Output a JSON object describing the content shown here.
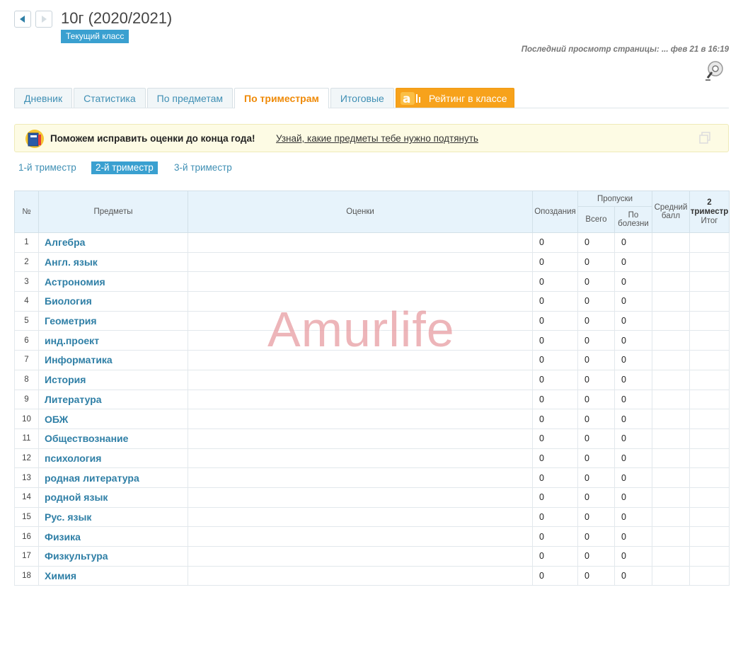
{
  "header": {
    "class_title": "10г (2020/2021)",
    "class_badge": "Текущий класс",
    "last_view": "Последний просмотр страницы: ... фев 21 в 16:19"
  },
  "tabs": [
    {
      "label": "Дневник"
    },
    {
      "label": "Статистика"
    },
    {
      "label": "По предметам"
    },
    {
      "label": "По триместрам"
    },
    {
      "label": "Итоговые"
    },
    {
      "label": "Рейтинг в классе"
    }
  ],
  "active_tab": "По триместрам",
  "banner": {
    "text": "Поможем исправить оценки до конца года!",
    "link": "Узнай, какие предметы тебе нужно подтянуть"
  },
  "trimesters": [
    {
      "label": "1-й триместр"
    },
    {
      "label": "2-й триместр"
    },
    {
      "label": "3-й триместр"
    }
  ],
  "active_trimester": "2-й триместр",
  "table": {
    "headers": {
      "num": "№",
      "subject": "Предметы",
      "grades": "Оценки",
      "late": "Опоздания",
      "absences": "Пропуски",
      "abs_total": "Всего",
      "abs_illness": "По болезни",
      "avg": "Средний балл",
      "final_1": "2",
      "final_2": "триместр",
      "final_3": "Итог"
    },
    "rows": [
      {
        "num": "1",
        "subject": "Алгебра",
        "late": "0",
        "total": "0",
        "illness": "0"
      },
      {
        "num": "2",
        "subject": "Англ. язык",
        "late": "0",
        "total": "0",
        "illness": "0"
      },
      {
        "num": "3",
        "subject": "Астрономия",
        "late": "0",
        "total": "0",
        "illness": "0"
      },
      {
        "num": "4",
        "subject": "Биология",
        "late": "0",
        "total": "0",
        "illness": "0"
      },
      {
        "num": "5",
        "subject": "Геометрия",
        "late": "0",
        "total": "0",
        "illness": "0"
      },
      {
        "num": "6",
        "subject": "инд.проект",
        "late": "0",
        "total": "0",
        "illness": "0"
      },
      {
        "num": "7",
        "subject": "Информатика",
        "late": "0",
        "total": "0",
        "illness": "0"
      },
      {
        "num": "8",
        "subject": "История",
        "late": "0",
        "total": "0",
        "illness": "0"
      },
      {
        "num": "9",
        "subject": "Литература",
        "late": "0",
        "total": "0",
        "illness": "0"
      },
      {
        "num": "10",
        "subject": "ОБЖ",
        "late": "0",
        "total": "0",
        "illness": "0"
      },
      {
        "num": "11",
        "subject": "Обществознание",
        "late": "0",
        "total": "0",
        "illness": "0"
      },
      {
        "num": "12",
        "subject": "психология",
        "late": "0",
        "total": "0",
        "illness": "0"
      },
      {
        "num": "13",
        "subject": "родная литература",
        "late": "0",
        "total": "0",
        "illness": "0"
      },
      {
        "num": "14",
        "subject": "родной язык",
        "late": "0",
        "total": "0",
        "illness": "0"
      },
      {
        "num": "15",
        "subject": "Рус. язык",
        "late": "0",
        "total": "0",
        "illness": "0"
      },
      {
        "num": "16",
        "subject": "Физика",
        "late": "0",
        "total": "0",
        "illness": "0"
      },
      {
        "num": "17",
        "subject": "Физкультура",
        "late": "0",
        "total": "0",
        "illness": "0"
      },
      {
        "num": "18",
        "subject": "Химия",
        "late": "0",
        "total": "0",
        "illness": "0"
      }
    ]
  },
  "watermark": "Amurlife",
  "colors": {
    "accent_blue": "#3aa0d0",
    "link_blue": "#2f7fa6",
    "active_orange": "#ef8a08",
    "rating_orange": "#f7a21b",
    "banner_bg": "#fdfbe4"
  }
}
